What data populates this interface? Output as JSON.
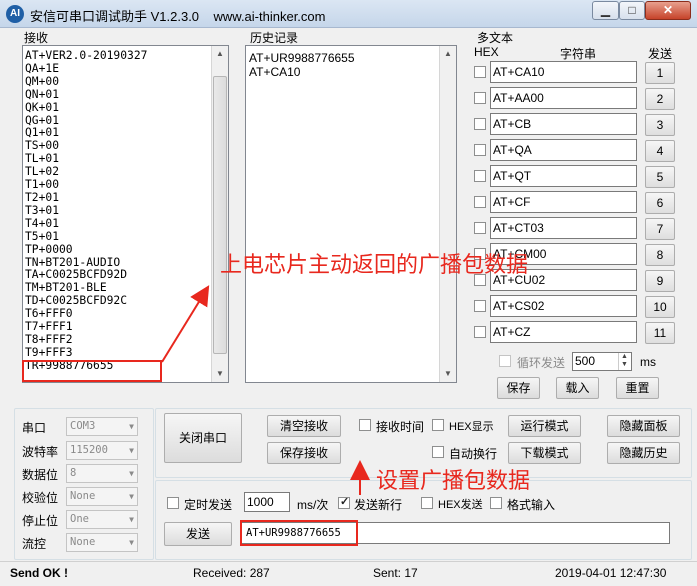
{
  "window": {
    "title": "安信可串口调试助手 V1.2.3.0",
    "url": "www.ai-thinker.com",
    "logo_text": "AI"
  },
  "receive": {
    "label": "接收",
    "lines": [
      "AT+VER2.0-20190327",
      "QA+1E",
      "QM+00",
      "QN+01",
      "QK+01",
      "QG+01",
      "Q1+01",
      "TS+00",
      "TL+01",
      "TL+02",
      "T1+00",
      "T2+01",
      "T3+01",
      "T4+01",
      "T5+01",
      "TP+0000",
      "TN+BT201-AUDIO",
      "TA+C0025BCFD92D",
      "TM+BT201-BLE",
      "TD+C0025BCFD92C",
      "T6+FFF0",
      "T7+FFF1",
      "T8+FFF2",
      "T9+FFF3",
      "TR+9988776655"
    ]
  },
  "history": {
    "label": "历史记录",
    "lines": [
      "AT+UR9988776655",
      "AT+CA10"
    ]
  },
  "multitext": {
    "label": "多文本",
    "col_hex": "HEX",
    "col_string": "字符串",
    "col_send": "发送",
    "rows": [
      {
        "text": "AT+CA10",
        "btn": "1"
      },
      {
        "text": "AT+AA00",
        "btn": "2"
      },
      {
        "text": "AT+CB",
        "btn": "3"
      },
      {
        "text": "AT+QA",
        "btn": "4"
      },
      {
        "text": "AT+QT",
        "btn": "5"
      },
      {
        "text": "AT+CF",
        "btn": "6"
      },
      {
        "text": "AT+CT03",
        "btn": "7"
      },
      {
        "text": "AT+CM00",
        "btn": "8"
      },
      {
        "text": "AT+CU02",
        "btn": "9"
      },
      {
        "text": "AT+CS02",
        "btn": "10"
      },
      {
        "text": "AT+CZ",
        "btn": "11"
      }
    ],
    "loop_send_label": "循环发送",
    "loop_interval": "500",
    "ms_label": "ms",
    "save_label": "保存",
    "load_label": "载入",
    "reset_label": "重置"
  },
  "port_settings": {
    "port_label": "串口",
    "port_value": "COM3",
    "baud_label": "波特率",
    "baud_value": "115200",
    "databits_label": "数据位",
    "databits_value": "8",
    "parity_label": "校验位",
    "parity_value": "None",
    "stopbits_label": "停止位",
    "stopbits_value": "One",
    "flow_label": "流控",
    "flow_value": "None"
  },
  "controls": {
    "close_port": "关闭串口",
    "clear_recv": "清空接收",
    "save_recv": "保存接收",
    "recv_time": "接收时间",
    "hex_display": "HEX显示",
    "run_mode": "运行模式",
    "hide_panel": "隐藏面板",
    "auto_wrap": "自动换行",
    "download_mode": "下载模式",
    "hide_history": "隐藏历史",
    "timed_send": "定时发送",
    "timed_interval": "1000",
    "ms_per": "ms/次",
    "send_newline": "发送新行",
    "hex_send": "HEX发送",
    "format_input": "格式输入",
    "send_button": "发送",
    "send_input_value": "AT+UR9988776655"
  },
  "annotations": {
    "broadcast_note": "上电芯片主动返回的广播包数据",
    "set_broadcast_note": "设置广播包数据",
    "color": "#e8281e"
  },
  "status": {
    "send_ok": "Send OK !",
    "received": "Received: 287",
    "sent": "Sent: 17",
    "datetime": "2019-04-01 12:47:30"
  }
}
